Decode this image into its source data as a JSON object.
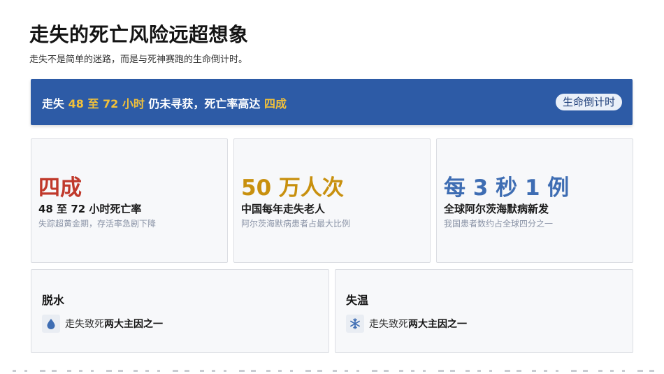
{
  "page": {
    "title": "走失的死亡风险远超想象",
    "subtitle": "走失不是简单的迷路，而是与死神赛跑的生命倒计时。"
  },
  "banner": {
    "part1": "走失 ",
    "hours": "48 至 72 小时",
    "part2": " 仍未寻获，死亡率高达 ",
    "rate": "四成",
    "badge": "生命倒计时",
    "colors": {
      "background": "#2d5ba6",
      "highlight": "#f2c13a"
    }
  },
  "stats": [
    {
      "big": "四成",
      "label": "48 至 72 小时死亡率",
      "note": "失踪超黄金期，存活率急剧下降",
      "color": "#c0392b"
    },
    {
      "big": "50 万人次",
      "label": "中国每年走失老人",
      "note": "阿尔茨海默病患者占最大比例",
      "color": "#c8900e"
    },
    {
      "big": "每 3 秒 1 例",
      "label": "全球阿尔茨海默病新发",
      "note": "我国患者数约占全球四分之一",
      "color": "#3e6db3"
    }
  ],
  "causes": [
    {
      "title": "脱水",
      "icon": "water-drop-icon",
      "prefix": "走失致死",
      "emphasis": "两大主因之一"
    },
    {
      "title": "失温",
      "icon": "snowflake-icon",
      "prefix": "走失致死",
      "emphasis": "两大主因之一"
    }
  ]
}
